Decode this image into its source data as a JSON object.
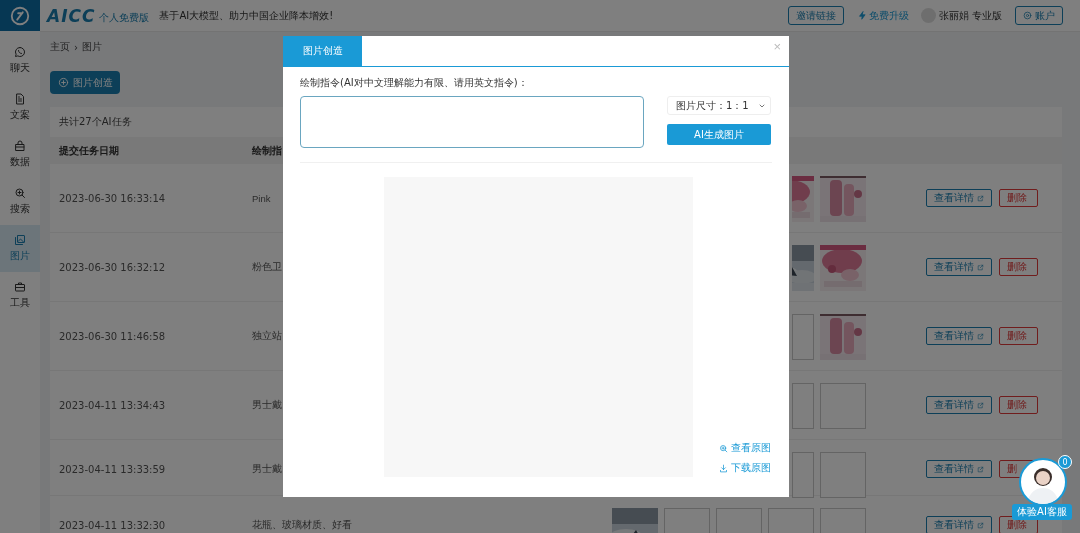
{
  "topbar": {
    "logo": "AICC",
    "logo_badge": "个人免费版",
    "tagline": "基于AI大模型、助力中国企业降本增效!",
    "invite_button": "邀请链接",
    "upgrade_link": "免费升级",
    "user_name": "张丽娟",
    "user_plan": "专业版",
    "account_button": "账户"
  },
  "sidebar": {
    "items": [
      {
        "label": "聊天",
        "selected": false
      },
      {
        "label": "文案",
        "selected": false
      },
      {
        "label": "数据",
        "selected": false
      },
      {
        "label": "搜索",
        "selected": false
      },
      {
        "label": "图片",
        "selected": true
      },
      {
        "label": "工具",
        "selected": false
      }
    ]
  },
  "breadcrumb": {
    "items": [
      "主页",
      "图片"
    ],
    "separator": "›"
  },
  "create_button": "图片创造",
  "task_count": "共计27个AI任务",
  "table": {
    "columns": [
      "提交任务日期",
      "绘制指"
    ],
    "rows": [
      {
        "date": "2023-06-30 16:33:14",
        "prompt": "Pink",
        "thumbnails": [
          {
            "kind": "picture"
          },
          {
            "kind": "picture"
          }
        ],
        "detail_button": "查看详情",
        "delete_button": "删除"
      },
      {
        "date": "2023-06-30 16:32:12",
        "prompt": "粉色卫",
        "thumbnails": [
          {
            "kind": "picture"
          },
          {
            "kind": "picture"
          }
        ],
        "detail_button": "查看详情",
        "delete_button": "删除"
      },
      {
        "date": "2023-06-30 11:46:58",
        "prompt": "独立站",
        "thumbnails": [
          {
            "kind": "empty"
          },
          {
            "kind": "picture"
          }
        ],
        "detail_button": "查看详情",
        "delete_button": "删除"
      },
      {
        "date": "2023-04-11 13:34:43",
        "prompt": "男士戴",
        "thumbnails": [
          {
            "kind": "empty"
          },
          {
            "kind": "empty"
          }
        ],
        "detail_button": "查看详情",
        "delete_button": "删除"
      },
      {
        "date": "2023-04-11 13:33:59",
        "prompt": "男士戴",
        "thumbnails": [
          {
            "kind": "empty"
          },
          {
            "kind": "empty"
          }
        ],
        "detail_button": "查看详情",
        "delete_button": "删"
      },
      {
        "date": "2023-04-11 13:32:30",
        "prompt": "花瓶、玻璃材质、好看",
        "thumbnails": [
          {
            "kind": "picture"
          },
          {
            "kind": "empty"
          },
          {
            "kind": "empty"
          },
          {
            "kind": "empty"
          },
          {
            "kind": "empty"
          }
        ],
        "detail_button": "查看详情",
        "delete_button": "删除"
      }
    ]
  },
  "modal": {
    "tab": "图片创造",
    "close": "×",
    "prompt_label": "绘制指令(AI对中文理解能力有限、请用英文指令)：",
    "size_select": "图片尺寸：1：1",
    "generate_button": "AI生成图片",
    "view_link": "查看原图",
    "download_link": "下载原图"
  },
  "chat_widget": {
    "badge": "0",
    "label": "体验AI客服"
  }
}
